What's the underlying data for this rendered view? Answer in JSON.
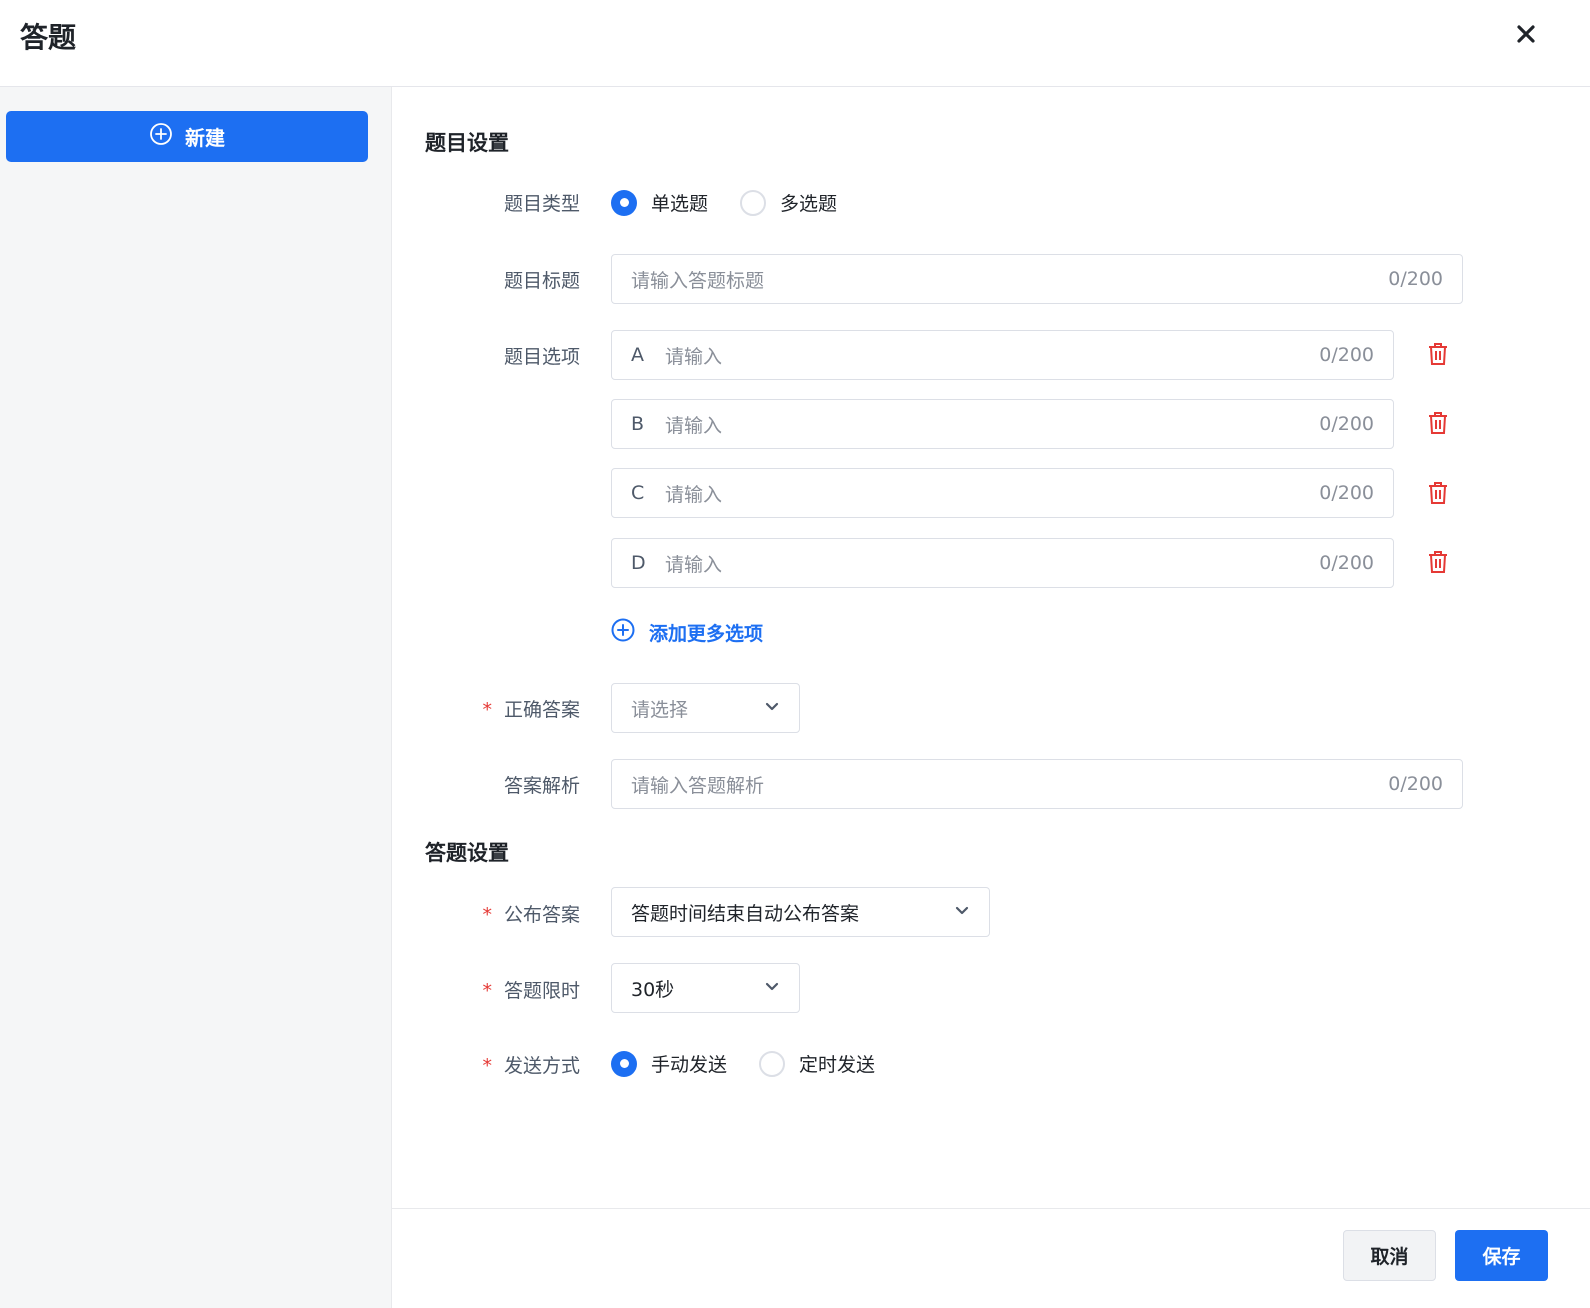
{
  "dialog": {
    "title": "答题"
  },
  "sidebar": {
    "new_button": "新建"
  },
  "question_settings": {
    "section_title": "题目设置",
    "type": {
      "label": "题目类型",
      "options": [
        {
          "label": "单选题",
          "selected": true
        },
        {
          "label": "多选题",
          "selected": false
        }
      ]
    },
    "title_field": {
      "label": "题目标题",
      "placeholder": "请输入答题标题",
      "counter": "0/200"
    },
    "options_field": {
      "label": "题目选项",
      "items": [
        {
          "letter": "A",
          "placeholder": "请输入",
          "counter": "0/200"
        },
        {
          "letter": "B",
          "placeholder": "请输入",
          "counter": "0/200"
        },
        {
          "letter": "C",
          "placeholder": "请输入",
          "counter": "0/200"
        },
        {
          "letter": "D",
          "placeholder": "请输入",
          "counter": "0/200"
        }
      ],
      "add_more": "添加更多选项"
    },
    "correct_answer": {
      "label": "正确答案",
      "required_mark": "*",
      "placeholder": "请选择"
    },
    "analysis": {
      "label": "答案解析",
      "placeholder": "请输入答题解析",
      "counter": "0/200"
    }
  },
  "answer_settings": {
    "section_title": "答题设置",
    "publish": {
      "label": "公布答案",
      "required_mark": "*",
      "value": "答题时间结束自动公布答案"
    },
    "time_limit": {
      "label": "答题限时",
      "required_mark": "*",
      "value": "30秒"
    },
    "send_mode": {
      "label": "发送方式",
      "required_mark": "*",
      "options": [
        {
          "label": "手动发送",
          "selected": true
        },
        {
          "label": "定时发送",
          "selected": false
        }
      ]
    }
  },
  "footer": {
    "cancel": "取消",
    "save": "保存"
  },
  "colors": {
    "primary": "#1d6ff2",
    "danger": "#e53935",
    "sidebar_bg": "#f5f6f7"
  }
}
